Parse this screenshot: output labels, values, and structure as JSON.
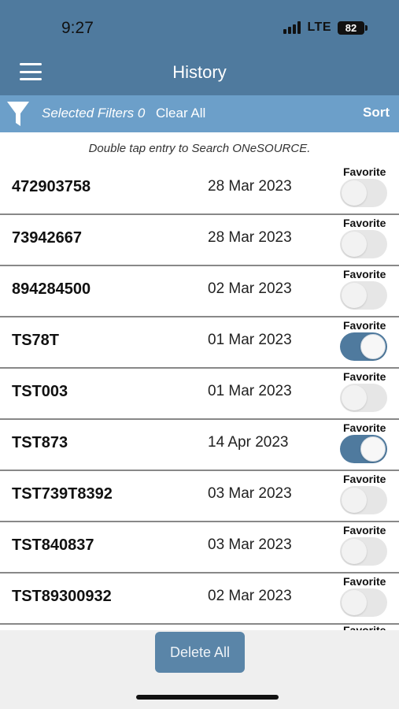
{
  "status": {
    "time": "9:27",
    "network": "LTE",
    "battery": "82"
  },
  "header": {
    "title": "History"
  },
  "filters": {
    "selected_label": "Selected Filters 0",
    "clear_label": "Clear All",
    "sort_label": "Sort"
  },
  "hint": "Double tap entry to Search ONeSOURCE.",
  "favorite_label": "Favorite",
  "rows": [
    {
      "id": "472903758",
      "date": "28 Mar 2023",
      "favorite": false
    },
    {
      "id": "73942667",
      "date": "28 Mar 2023",
      "favorite": false
    },
    {
      "id": "894284500",
      "date": "02 Mar 2023",
      "favorite": false
    },
    {
      "id": "TS78T",
      "date": "01 Mar 2023",
      "favorite": true
    },
    {
      "id": "TST003",
      "date": "01 Mar 2023",
      "favorite": false
    },
    {
      "id": "TST873",
      "date": "14 Apr 2023",
      "favorite": true
    },
    {
      "id": "TST739T8392",
      "date": "03 Mar 2023",
      "favorite": false
    },
    {
      "id": "TST840837",
      "date": "03 Mar 2023",
      "favorite": false
    },
    {
      "id": "TST89300932",
      "date": "02 Mar 2023",
      "favorite": false
    }
  ],
  "actions": {
    "delete_all": "Delete All"
  },
  "colors": {
    "header": "#4f7a9e",
    "filterbar": "#6c9fc9",
    "toggle_on": "#4f7a9e"
  }
}
